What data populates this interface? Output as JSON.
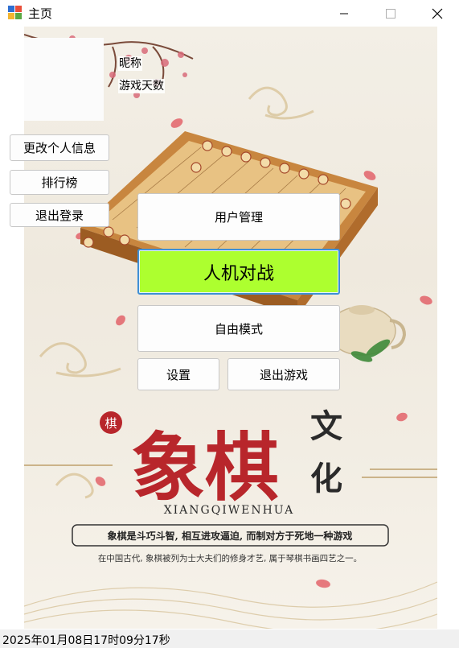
{
  "window": {
    "title": "主页",
    "controls": {
      "minimize": "minimize-icon",
      "maximize": "maximize-icon",
      "close": "close-icon"
    }
  },
  "profile": {
    "nickname_label": "昵称",
    "game_days_label": "游戏天数"
  },
  "side_buttons": {
    "edit_profile": "更改个人信息",
    "leaderboard": "排行榜",
    "logout": "退出登录"
  },
  "main_buttons": {
    "user_management": "用户管理",
    "pve": "人机对战",
    "free_mode": "自由模式",
    "settings": "设置",
    "exit_game": "退出游戏"
  },
  "poster": {
    "seal_char": "棋",
    "big_title": "象棋",
    "side_title_1": "文",
    "side_title_2": "化",
    "pinyin": "XIANGQIWENHUA",
    "slogan": "象棋是斗巧斗智, 相互进攻逼迫, 而制对方于死地一种游戏",
    "caption": "在中国古代, 象棋被列为士大夫们的修身才艺, 属于琴棋书画四艺之一。"
  },
  "status": {
    "datetime": "2025年01月08日17时09分17秒"
  },
  "colors": {
    "pve_button_bg": "#adff2f",
    "pve_button_border": "#3f8fd6",
    "poster_red": "#b8262b",
    "poster_dark": "#2a2a2a"
  }
}
